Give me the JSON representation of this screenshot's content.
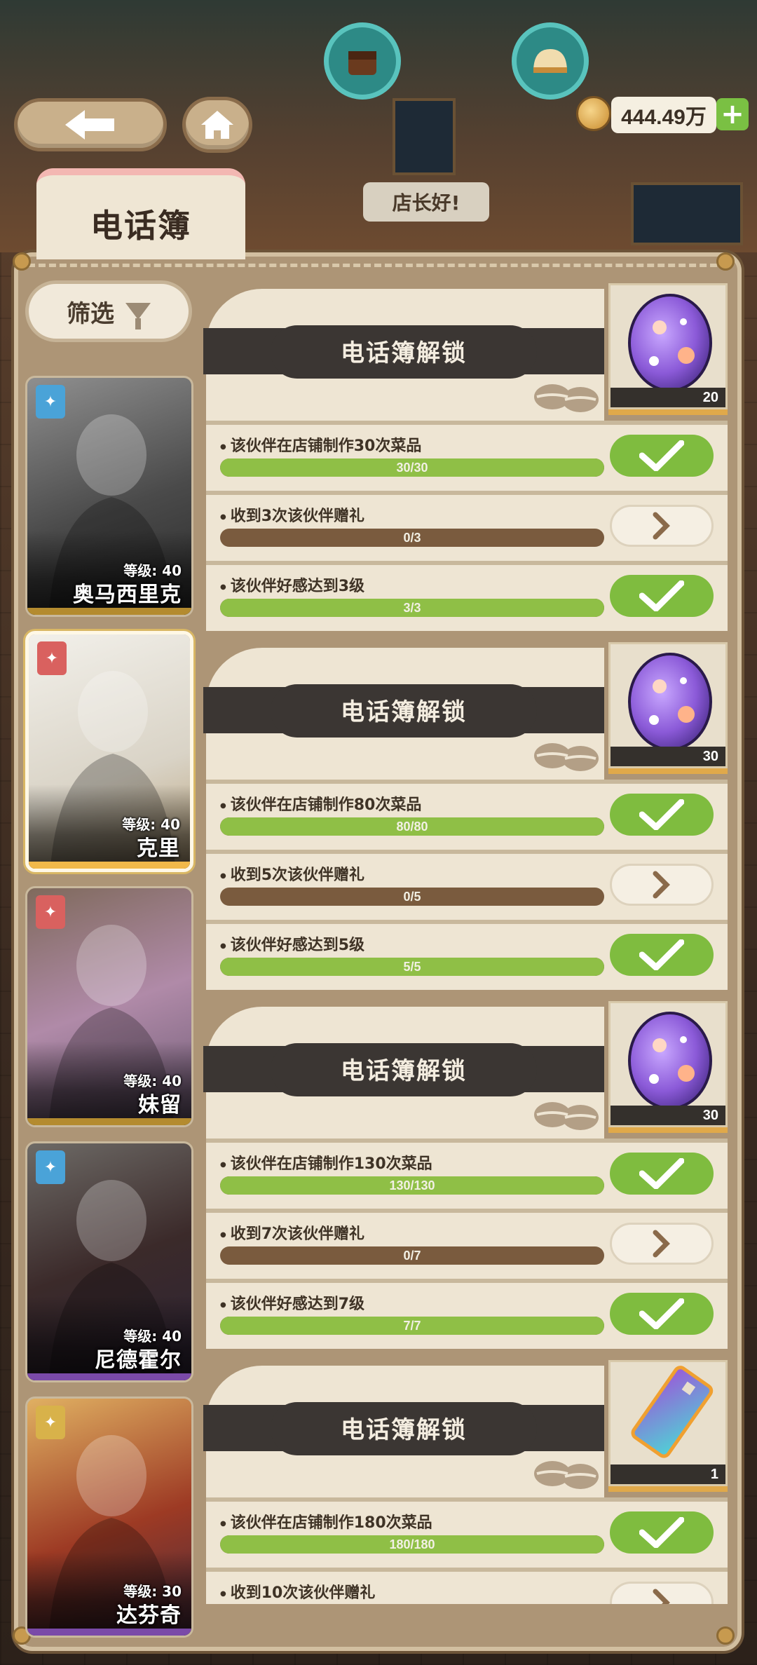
{
  "header": {
    "back_icon": "arrow-left-icon",
    "home_icon": "home-icon",
    "currency": "444.49万",
    "plus": "+",
    "greeting": "店长好!",
    "title": "电话簿"
  },
  "filter": {
    "label": "筛选",
    "icon": "funnel-icon"
  },
  "characters": [
    {
      "name": "奥马西里克",
      "level": "等级: 40",
      "badge_color": "#4aa3d8",
      "selected": false
    },
    {
      "name": "克里",
      "level": "等级: 40",
      "badge_color": "#d9615f",
      "selected": true
    },
    {
      "name": "妹留",
      "level": "等级: 40",
      "badge_color": "#d9615f",
      "selected": false
    },
    {
      "name": "尼德霍尔",
      "level": "等级: 40",
      "badge_color": "#4aa3d8",
      "selected": false
    },
    {
      "name": "达芬奇",
      "level": "等级: 30",
      "badge_color": "#d8b24a",
      "selected": false
    }
  ],
  "unlocks": [
    {
      "title": "电话簿解锁",
      "reward": {
        "icon": "purple-egg-icon",
        "count": "20"
      },
      "tasks": [
        {
          "label": "该伙伴在店铺制作30次菜品",
          "progress": "30/30",
          "fraction": 1,
          "status": "done"
        },
        {
          "label": "收到3次该伙伴赠礼",
          "progress": "0/3",
          "fraction": 0,
          "status": "go"
        },
        {
          "label": "该伙伴好感达到3级",
          "progress": "3/3",
          "fraction": 1,
          "status": "done"
        }
      ]
    },
    {
      "title": "电话簿解锁",
      "reward": {
        "icon": "purple-egg-icon",
        "count": "30"
      },
      "tasks": [
        {
          "label": "该伙伴在店铺制作80次菜品",
          "progress": "80/80",
          "fraction": 1,
          "status": "done"
        },
        {
          "label": "收到5次该伙伴赠礼",
          "progress": "0/5",
          "fraction": 0,
          "status": "go"
        },
        {
          "label": "该伙伴好感达到5级",
          "progress": "5/5",
          "fraction": 1,
          "status": "done"
        }
      ]
    },
    {
      "title": "电话簿解锁",
      "reward": {
        "icon": "purple-egg-icon",
        "count": "30"
      },
      "tasks": [
        {
          "label": "该伙伴在店铺制作130次菜品",
          "progress": "130/130",
          "fraction": 1,
          "status": "done"
        },
        {
          "label": "收到7次该伙伴赠礼",
          "progress": "0/7",
          "fraction": 0,
          "status": "go"
        },
        {
          "label": "该伙伴好感达到7级",
          "progress": "7/7",
          "fraction": 1,
          "status": "done"
        }
      ]
    },
    {
      "title": "电话簿解锁",
      "reward": {
        "icon": "phone-card-icon",
        "count": "1"
      },
      "tasks": [
        {
          "label": "该伙伴在店铺制作180次菜品",
          "progress": "180/180",
          "fraction": 1,
          "status": "done"
        },
        {
          "label": "收到10次该伙伴赠礼",
          "progress": "",
          "fraction": 0,
          "status": "go"
        }
      ]
    }
  ]
}
